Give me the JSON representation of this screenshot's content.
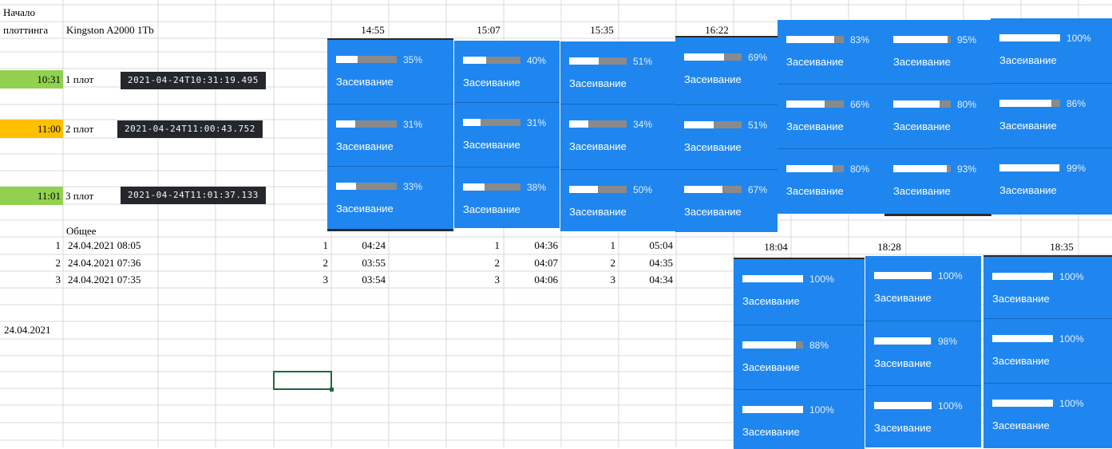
{
  "sheet": {
    "header_line1": "Начало",
    "header_line2": "плоттинга",
    "drive": "Kingston A2000 1Tb",
    "plots": [
      {
        "start": "10:31",
        "name": "1 плот",
        "timestamp": "2021-04-24T10:31:19.495",
        "color": "#92d050"
      },
      {
        "start": "11:00",
        "name": "2 плот",
        "timestamp": "2021-04-24T11:00:43.752",
        "color": "#ffc000"
      },
      {
        "start": "11:01",
        "name": "3 плот",
        "timestamp": "2021-04-24T11:01:37.133",
        "color": "#92d050"
      }
    ],
    "total_label": "Общее",
    "totals": [
      {
        "n": "1",
        "date": "24.04.2021 08:05"
      },
      {
        "n": "2",
        "date": "24.04.2021 07:36"
      },
      {
        "n": "3",
        "date": "24.04.2021 07:35"
      }
    ],
    "date_cell": "24.04.2021"
  },
  "time_headers": [
    "14:55",
    "15:07",
    "15:35",
    "16:22",
    "18:04",
    "18:28",
    "18:35"
  ],
  "durations": [
    {
      "rows": [
        {
          "n": "1",
          "t": "04:24"
        },
        {
          "n": "2",
          "t": "03:55"
        },
        {
          "n": "3",
          "t": "03:54"
        }
      ]
    },
    {
      "rows": [
        {
          "n": "1",
          "t": "04:36"
        },
        {
          "n": "2",
          "t": "04:07"
        },
        {
          "n": "3",
          "t": "04:06"
        }
      ]
    },
    {
      "rows": [
        {
          "n": "1",
          "t": "05:04"
        },
        {
          "n": "2",
          "t": "04:35"
        },
        {
          "n": "3",
          "t": "04:34"
        }
      ]
    }
  ],
  "stage_label": "Засеивание",
  "snapshots": [
    {
      "progress": [
        35,
        31,
        33
      ]
    },
    {
      "progress": [
        40,
        31,
        38
      ]
    },
    {
      "progress": [
        51,
        34,
        50
      ]
    },
    {
      "progress": [
        69,
        51,
        67
      ]
    },
    {
      "progress": [
        83,
        66,
        80
      ]
    },
    {
      "progress": [
        95,
        80,
        93
      ]
    },
    {
      "progress": [
        100,
        86,
        99
      ]
    },
    {
      "progress": [
        100,
        88,
        100
      ]
    },
    {
      "progress": [
        100,
        98,
        100
      ]
    },
    {
      "progress": [
        100,
        100,
        100
      ]
    }
  ],
  "colors": {
    "card": "#1f86f0",
    "grid": "#d9d9d9",
    "chip": "#24282c",
    "selection": "#1e6b3c"
  }
}
